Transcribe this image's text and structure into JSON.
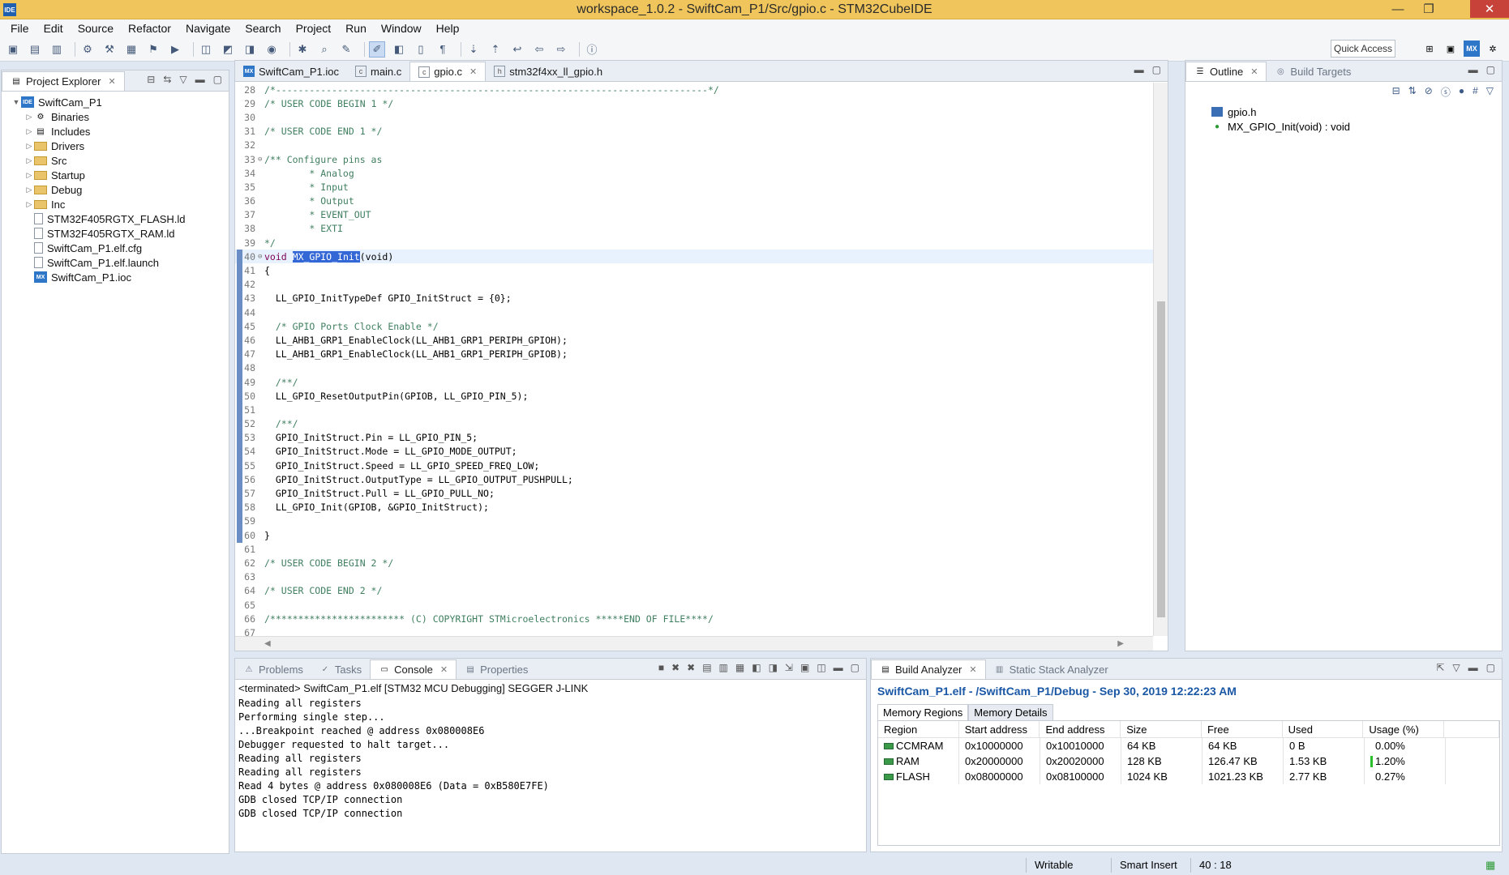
{
  "window": {
    "title": "workspace_1.0.2 - SwiftCam_P1/Src/gpio.c - STM32CubeIDE",
    "app_icon_text": "IDE",
    "controls": [
      "—",
      "❐",
      "✕"
    ]
  },
  "menu": [
    "File",
    "Edit",
    "Source",
    "Refactor",
    "Navigate",
    "Search",
    "Project",
    "Run",
    "Window",
    "Help"
  ],
  "toolbar": {
    "quick_access": "Quick Access",
    "perspective_mx": "MX"
  },
  "project_explorer": {
    "tab_label": "Project Explorer",
    "items": [
      {
        "label": "SwiftCam_P1",
        "type": "project",
        "twisty": "▼",
        "indent": 0
      },
      {
        "label": "Binaries",
        "type": "binaries",
        "twisty": "▷",
        "indent": 1
      },
      {
        "label": "Includes",
        "type": "includes",
        "twisty": "▷",
        "indent": 1
      },
      {
        "label": "Drivers",
        "type": "folder",
        "twisty": "▷",
        "indent": 1
      },
      {
        "label": "Src",
        "type": "folder",
        "twisty": "▷",
        "indent": 1
      },
      {
        "label": "Startup",
        "type": "folder",
        "twisty": "▷",
        "indent": 1
      },
      {
        "label": "Debug",
        "type": "folder",
        "twisty": "▷",
        "indent": 1
      },
      {
        "label": "Inc",
        "type": "folder",
        "twisty": "▷",
        "indent": 1
      },
      {
        "label": "STM32F405RGTX_FLASH.ld",
        "type": "file",
        "twisty": "",
        "indent": 1
      },
      {
        "label": "STM32F405RGTX_RAM.ld",
        "type": "file",
        "twisty": "",
        "indent": 1
      },
      {
        "label": "SwiftCam_P1.elf.cfg",
        "type": "file",
        "twisty": "",
        "indent": 1
      },
      {
        "label": "SwiftCam_P1.elf.launch",
        "type": "file",
        "twisty": "",
        "indent": 1
      },
      {
        "label": "SwiftCam_P1.ioc",
        "type": "mx",
        "twisty": "",
        "indent": 1
      }
    ]
  },
  "editor": {
    "tabs": [
      {
        "label": "SwiftCam_P1.ioc",
        "icon": "MX",
        "active": false
      },
      {
        "label": "main.c",
        "icon": "c",
        "active": false
      },
      {
        "label": "gpio.c",
        "icon": "c",
        "active": true
      },
      {
        "label": "stm32f4xx_ll_gpio.h",
        "icon": "h",
        "active": false
      }
    ],
    "lines": [
      {
        "n": "28",
        "text": "/*-----------------------------------------------------------------------------*/",
        "cls": "cmt"
      },
      {
        "n": "29",
        "text": "/* USER CODE BEGIN 1 */",
        "cls": "cmt"
      },
      {
        "n": "30",
        "text": "",
        "cls": "code"
      },
      {
        "n": "31",
        "text": "/* USER CODE END 1 */",
        "cls": "cmt"
      },
      {
        "n": "32",
        "text": "",
        "cls": "code"
      },
      {
        "n": "33",
        "text": "/** Configure pins as",
        "cls": "cmt",
        "fold": "⊖"
      },
      {
        "n": "34",
        "text": "        * Analog",
        "cls": "cmt"
      },
      {
        "n": "35",
        "text": "        * Input",
        "cls": "cmt"
      },
      {
        "n": "36",
        "text": "        * Output",
        "cls": "cmt"
      },
      {
        "n": "37",
        "text": "        * EVENT_OUT",
        "cls": "cmt"
      },
      {
        "n": "38",
        "text": "        * EXTI",
        "cls": "cmt"
      },
      {
        "n": "39",
        "text": "*/",
        "cls": "cmt"
      },
      {
        "n": "40",
        "text": "",
        "cls": "code",
        "fold": "⊖",
        "special": "decl"
      },
      {
        "n": "41",
        "text": "{",
        "cls": "code"
      },
      {
        "n": "42",
        "text": "",
        "cls": "code"
      },
      {
        "n": "43",
        "text": "  LL_GPIO_InitTypeDef GPIO_InitStruct = {0};",
        "cls": "code"
      },
      {
        "n": "44",
        "text": "",
        "cls": "code"
      },
      {
        "n": "45",
        "text": "  /* GPIO Ports Clock Enable */",
        "cls": "cmt"
      },
      {
        "n": "46",
        "text": "  LL_AHB1_GRP1_EnableClock(LL_AHB1_GRP1_PERIPH_GPIOH);",
        "cls": "code"
      },
      {
        "n": "47",
        "text": "  LL_AHB1_GRP1_EnableClock(LL_AHB1_GRP1_PERIPH_GPIOB);",
        "cls": "code"
      },
      {
        "n": "48",
        "text": "",
        "cls": "code"
      },
      {
        "n": "49",
        "text": "  /**/",
        "cls": "cmt"
      },
      {
        "n": "50",
        "text": "  LL_GPIO_ResetOutputPin(GPIOB, LL_GPIO_PIN_5);",
        "cls": "code"
      },
      {
        "n": "51",
        "text": "",
        "cls": "code"
      },
      {
        "n": "52",
        "text": "  /**/",
        "cls": "cmt"
      },
      {
        "n": "53",
        "text": "  GPIO_InitStruct.Pin = LL_GPIO_PIN_5;",
        "cls": "code"
      },
      {
        "n": "54",
        "text": "  GPIO_InitStruct.Mode = LL_GPIO_MODE_OUTPUT;",
        "cls": "code"
      },
      {
        "n": "55",
        "text": "  GPIO_InitStruct.Speed = LL_GPIO_SPEED_FREQ_LOW;",
        "cls": "code"
      },
      {
        "n": "56",
        "text": "  GPIO_InitStruct.OutputType = LL_GPIO_OUTPUT_PUSHPULL;",
        "cls": "code"
      },
      {
        "n": "57",
        "text": "  GPIO_InitStruct.Pull = LL_GPIO_PULL_NO;",
        "cls": "code"
      },
      {
        "n": "58",
        "text": "  LL_GPIO_Init(GPIOB, &GPIO_InitStruct);",
        "cls": "code"
      },
      {
        "n": "59",
        "text": "",
        "cls": "code"
      },
      {
        "n": "60",
        "text": "}",
        "cls": "code"
      },
      {
        "n": "61",
        "text": "",
        "cls": "code"
      },
      {
        "n": "62",
        "text": "/* USER CODE BEGIN 2 */",
        "cls": "cmt"
      },
      {
        "n": "63",
        "text": "",
        "cls": "code"
      },
      {
        "n": "64",
        "text": "/* USER CODE END 2 */",
        "cls": "cmt"
      },
      {
        "n": "65",
        "text": "",
        "cls": "code"
      },
      {
        "n": "66",
        "text": "/************************ (C) COPYRIGHT STMicroelectronics *****END OF FILE****/",
        "cls": "cmt"
      },
      {
        "n": "67",
        "text": "",
        "cls": "code"
      }
    ],
    "decl": {
      "kw": "void",
      "selected": "MX_GPIO_Init",
      "rest": "(void)"
    }
  },
  "outline": {
    "tabs": [
      "Outline",
      "Build Targets"
    ],
    "items": [
      {
        "label": "gpio.h",
        "icon": "include"
      },
      {
        "label": "MX_GPIO_Init(void) : void",
        "icon": "function"
      }
    ]
  },
  "console": {
    "tabs": [
      "Problems",
      "Tasks",
      "Console",
      "Properties"
    ],
    "header": "<terminated> SwiftCam_P1.elf [STM32 MCU Debugging] SEGGER J-LINK",
    "lines": [
      "Reading all registers",
      "Performing single step...",
      "...Breakpoint reached @ address 0x080008E6",
      "Debugger requested to halt target...",
      "Reading all registers",
      "Reading all registers",
      "Read 4 bytes @ address 0x080008E6 (Data = 0xB580E7FE)",
      "GDB closed TCP/IP connection",
      "GDB closed TCP/IP connection"
    ]
  },
  "build_analyzer": {
    "tabs": [
      "Build Analyzer",
      "Static Stack Analyzer"
    ],
    "title": "SwiftCam_P1.elf - /SwiftCam_P1/Debug - Sep 30, 2019 12:22:23 AM",
    "subtabs": [
      "Memory Regions",
      "Memory Details"
    ],
    "columns": [
      "Region",
      "Start address",
      "End address",
      "Size",
      "Free",
      "Used",
      "Usage (%)"
    ],
    "rows": [
      {
        "region": "CCMRAM",
        "start": "0x10000000",
        "end": "0x10010000",
        "size": "64 KB",
        "free": "64 KB",
        "used": "0 B",
        "usage": "0.00%"
      },
      {
        "region": "RAM",
        "start": "0x20000000",
        "end": "0x20020000",
        "size": "128 KB",
        "free": "126.47 KB",
        "used": "1.53 KB",
        "usage": "1.20%"
      },
      {
        "region": "FLASH",
        "start": "0x08000000",
        "end": "0x08100000",
        "size": "1024 KB",
        "free": "1021.23 KB",
        "used": "2.77 KB",
        "usage": "0.27%"
      }
    ]
  },
  "status": {
    "writable": "Writable",
    "insert_mode": "Smart Insert",
    "position": "40 : 18"
  }
}
